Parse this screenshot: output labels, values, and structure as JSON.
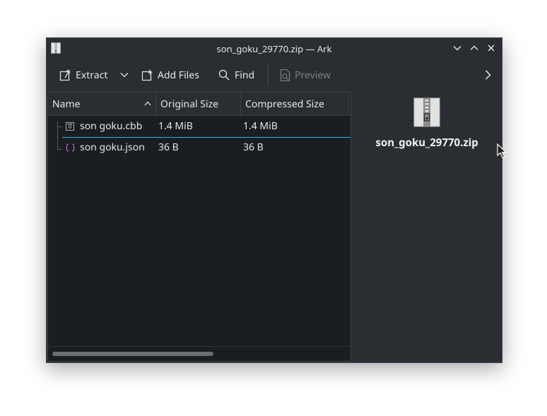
{
  "window": {
    "title": "son_goku_29770.zip — Ark"
  },
  "toolbar": {
    "extract_label": "Extract",
    "add_files_label": "Add Files",
    "find_label": "Find",
    "preview_label": "Preview"
  },
  "table": {
    "columns": [
      "Name",
      "Original Size",
      "Compressed Size"
    ],
    "rows": [
      {
        "name": "son goku.cbb",
        "original_size": "1.4 MiB",
        "compressed_size": "1.4 MiB"
      },
      {
        "name": "son goku.json",
        "original_size": "36 B",
        "compressed_size": "36 B"
      }
    ]
  },
  "info_panel": {
    "archive_name": "son_goku_29770.zip"
  },
  "colors": {
    "window_bg": "#2a2e32",
    "list_bg": "#1b1e20",
    "accent": "#3daee9",
    "json_icon": "#b86fd6"
  },
  "icons": {
    "app": "ark-icon",
    "minimize": "chevron-down-icon",
    "maximize": "chevron-up-icon",
    "close": "close-icon",
    "extract": "extract-icon",
    "add_files": "add-files-icon",
    "find": "search-icon",
    "preview": "preview-icon",
    "more": "chevron-right-icon",
    "archive": "zip-archive-icon"
  }
}
